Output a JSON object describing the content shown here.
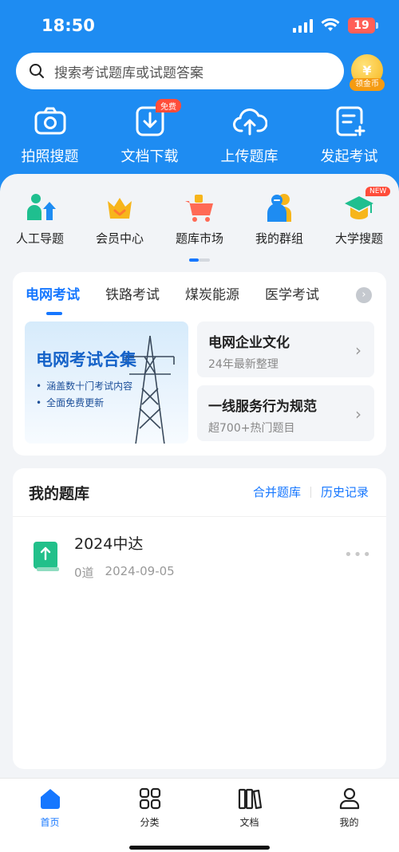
{
  "status": {
    "time": "18:50",
    "battery": "19"
  },
  "search": {
    "placeholder": "搜索考试题库或试题答案"
  },
  "coin": {
    "symbol": "¥",
    "label": "领金币"
  },
  "top_actions": [
    {
      "label": "拍照搜题",
      "icon": "camera-icon"
    },
    {
      "label": "文档下载",
      "icon": "download-icon",
      "badge": "免费"
    },
    {
      "label": "上传题库",
      "icon": "cloud-upload-icon"
    },
    {
      "label": "发起考试",
      "icon": "exam-create-icon"
    }
  ],
  "quick_items": [
    {
      "label": "人工导题",
      "icon": "person-import-icon"
    },
    {
      "label": "会员中心",
      "icon": "crown-icon"
    },
    {
      "label": "题库市场",
      "icon": "cart-icon"
    },
    {
      "label": "我的群组",
      "icon": "group-icon"
    },
    {
      "label": "大学搜题",
      "icon": "graduation-cap-icon",
      "badge": "NEW"
    }
  ],
  "category": {
    "tabs": [
      "电网考试",
      "铁路考试",
      "煤炭能源",
      "医学考试"
    ],
    "active_tab": 0,
    "banner": {
      "title": "电网考试合集",
      "lines": [
        "涵盖数十门考试内容",
        "全面免费更新"
      ]
    },
    "items": [
      {
        "title": "电网企业文化",
        "subtitle": "24年最新整理"
      },
      {
        "title": "一线服务行为规范",
        "subtitle": "超700+热门题目"
      }
    ]
  },
  "my_bank": {
    "title": "我的题库",
    "merge_label": "合并题库",
    "history_label": "历史记录",
    "items": [
      {
        "name": "2024中达",
        "count": "0道",
        "date": "2024-09-05"
      }
    ]
  },
  "tabbar": [
    {
      "label": "首页",
      "icon": "home-icon",
      "active": true
    },
    {
      "label": "分类",
      "icon": "grid-icon"
    },
    {
      "label": "文档",
      "icon": "books-icon"
    },
    {
      "label": "我的",
      "icon": "user-icon"
    }
  ],
  "colors": {
    "brand": "#1e8cf2",
    "accent": "#1677ff",
    "badge": "#ff4d3a"
  }
}
